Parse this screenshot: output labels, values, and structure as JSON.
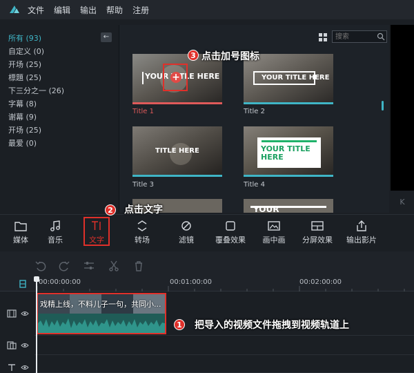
{
  "menu": {
    "items": [
      "文件",
      "编辑",
      "输出",
      "帮助",
      "注册"
    ]
  },
  "sidebar": {
    "categories": [
      {
        "label": "所有 (93)",
        "active": true
      },
      {
        "label": "自定义 (0)"
      },
      {
        "label": "开场 (25)"
      },
      {
        "label": "標題 (25)"
      },
      {
        "label": "下三分之一 (26)"
      },
      {
        "label": "字幕 (8)"
      },
      {
        "label": "谢幕 (9)"
      },
      {
        "label": "开场 (25)"
      },
      {
        "label": "最爱 (0)"
      }
    ],
    "collapse_label": "←"
  },
  "search": {
    "placeholder": "搜索"
  },
  "thumbnails": [
    {
      "label": "Title 1",
      "caption": "YOUR TITLE HERE",
      "accent": "#e05a5a"
    },
    {
      "label": "Title 2",
      "caption": "YOUR TITLE HERE",
      "accent": "#3fb5c6"
    },
    {
      "label": "Title 3",
      "caption": "TITLE HERE",
      "accent": "#3fb5c6"
    },
    {
      "label": "Title 4",
      "caption": "YOUR TITLE HERE",
      "accent": "#3fb5c6"
    },
    {
      "label": "",
      "caption": "YOUR",
      "accent": "#3fb5c6"
    }
  ],
  "preview": {
    "corner_label": "K"
  },
  "toolbar": {
    "items": [
      {
        "key": "media",
        "label": "媒体"
      },
      {
        "key": "music",
        "label": "音乐"
      },
      {
        "key": "text",
        "label": "文字"
      },
      {
        "key": "transition",
        "label": "转场"
      },
      {
        "key": "filter",
        "label": "滤镜"
      },
      {
        "key": "overlay",
        "label": "覆叠效果"
      },
      {
        "key": "pip",
        "label": "画中画"
      },
      {
        "key": "split",
        "label": "分屏效果"
      },
      {
        "key": "export",
        "label": "输出影片"
      }
    ]
  },
  "timeline": {
    "times": [
      "00:00:00:00",
      "00:01:00:00",
      "00:02:00:00"
    ],
    "clip_title": "戏精上线，不料儿子一句，共同小..."
  },
  "annotations": {
    "step1": {
      "num": "1",
      "text": "把导入的视频文件拖拽到视频轨道上"
    },
    "step2": {
      "num": "2",
      "text": "点击文字"
    },
    "step3": {
      "num": "3",
      "text": "点击加号图标"
    },
    "add_symbol": "+"
  },
  "colors": {
    "accent": "#3fb5c6",
    "highlight": "#e0302a",
    "background": "#1b1f24"
  }
}
